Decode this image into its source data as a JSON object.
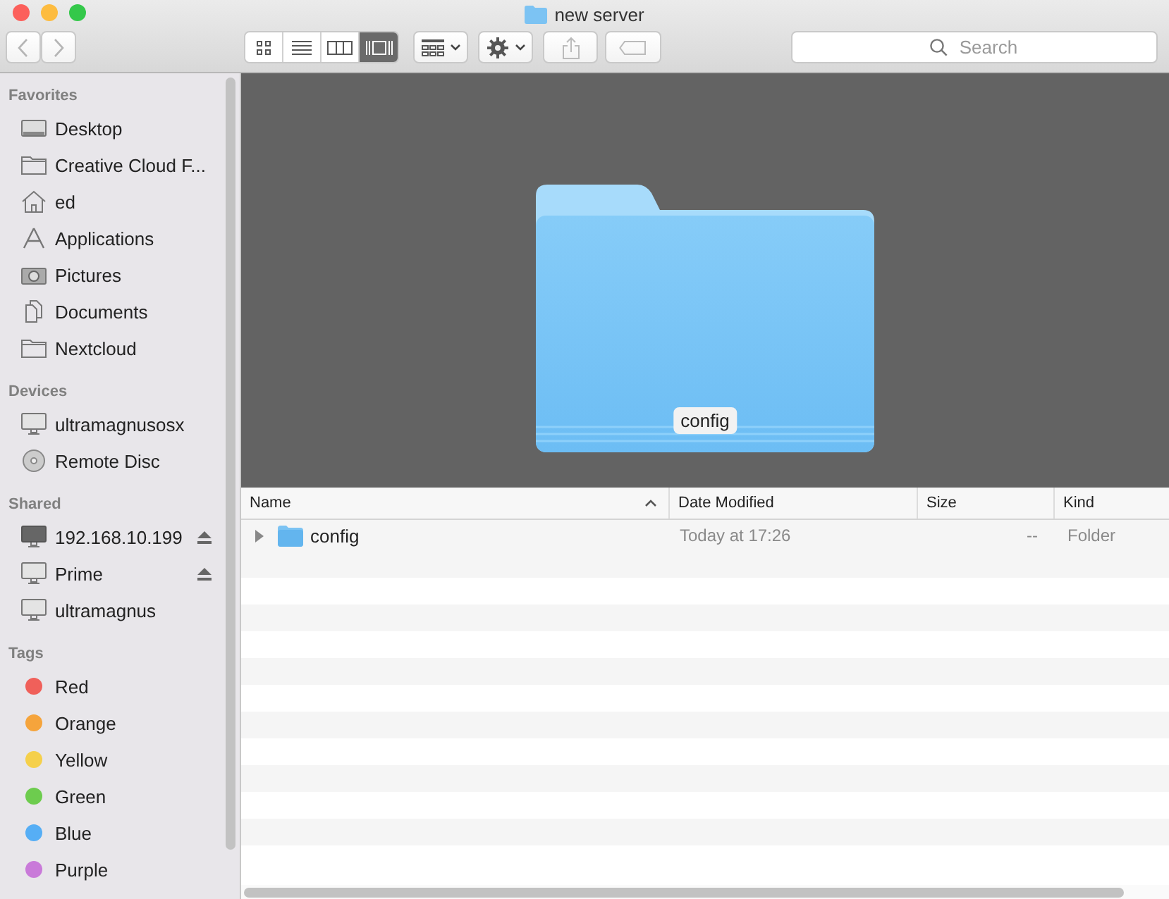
{
  "window": {
    "title": "new server"
  },
  "view_modes": [
    {
      "kind": "icons",
      "selected": false
    },
    {
      "kind": "list",
      "selected": false
    },
    {
      "kind": "columns",
      "selected": false
    },
    {
      "kind": "coverflow",
      "selected": true
    }
  ],
  "search": {
    "placeholder": "Search"
  },
  "sidebar": {
    "sections": [
      {
        "title": "Favorites",
        "items": [
          {
            "label": "Desktop",
            "kind": "desktop"
          },
          {
            "label": "Creative Cloud F...",
            "kind": "folder"
          },
          {
            "label": "ed",
            "kind": "home"
          },
          {
            "label": "Applications",
            "kind": "apps"
          },
          {
            "label": "Pictures",
            "kind": "camera"
          },
          {
            "label": "Documents",
            "kind": "docs"
          },
          {
            "label": "Nextcloud",
            "kind": "folder"
          }
        ]
      },
      {
        "title": "Devices",
        "items": [
          {
            "label": "ultramagnusosx",
            "kind": "computer"
          },
          {
            "label": "Remote Disc",
            "kind": "disc"
          }
        ]
      },
      {
        "title": "Shared",
        "items": [
          {
            "label": "192.168.10.199",
            "kind": "screen",
            "eject": true
          },
          {
            "label": "Prime",
            "kind": "computer",
            "eject": true
          },
          {
            "label": "ultramagnus",
            "kind": "computer",
            "eject": false
          }
        ]
      },
      {
        "title": "Tags",
        "items": [
          {
            "label": "Red",
            "kind": "tag",
            "color": "#f0605a"
          },
          {
            "label": "Orange",
            "kind": "tag",
            "color": "#f5a43c"
          },
          {
            "label": "Yellow",
            "kind": "tag",
            "color": "#f5d04b"
          },
          {
            "label": "Green",
            "kind": "tag",
            "color": "#6dcc4e"
          },
          {
            "label": "Blue",
            "kind": "tag",
            "color": "#56aef5"
          },
          {
            "label": "Purple",
            "kind": "tag",
            "color": "#c97ad9"
          }
        ]
      }
    ]
  },
  "preview": {
    "label": "config"
  },
  "table": {
    "columns": [
      "Name",
      "Date Modified",
      "Size",
      "Kind"
    ],
    "rows": [
      {
        "name": "config",
        "date": "Today at 17:26",
        "size": "--",
        "kind": "Folder",
        "expanded": false
      }
    ]
  }
}
